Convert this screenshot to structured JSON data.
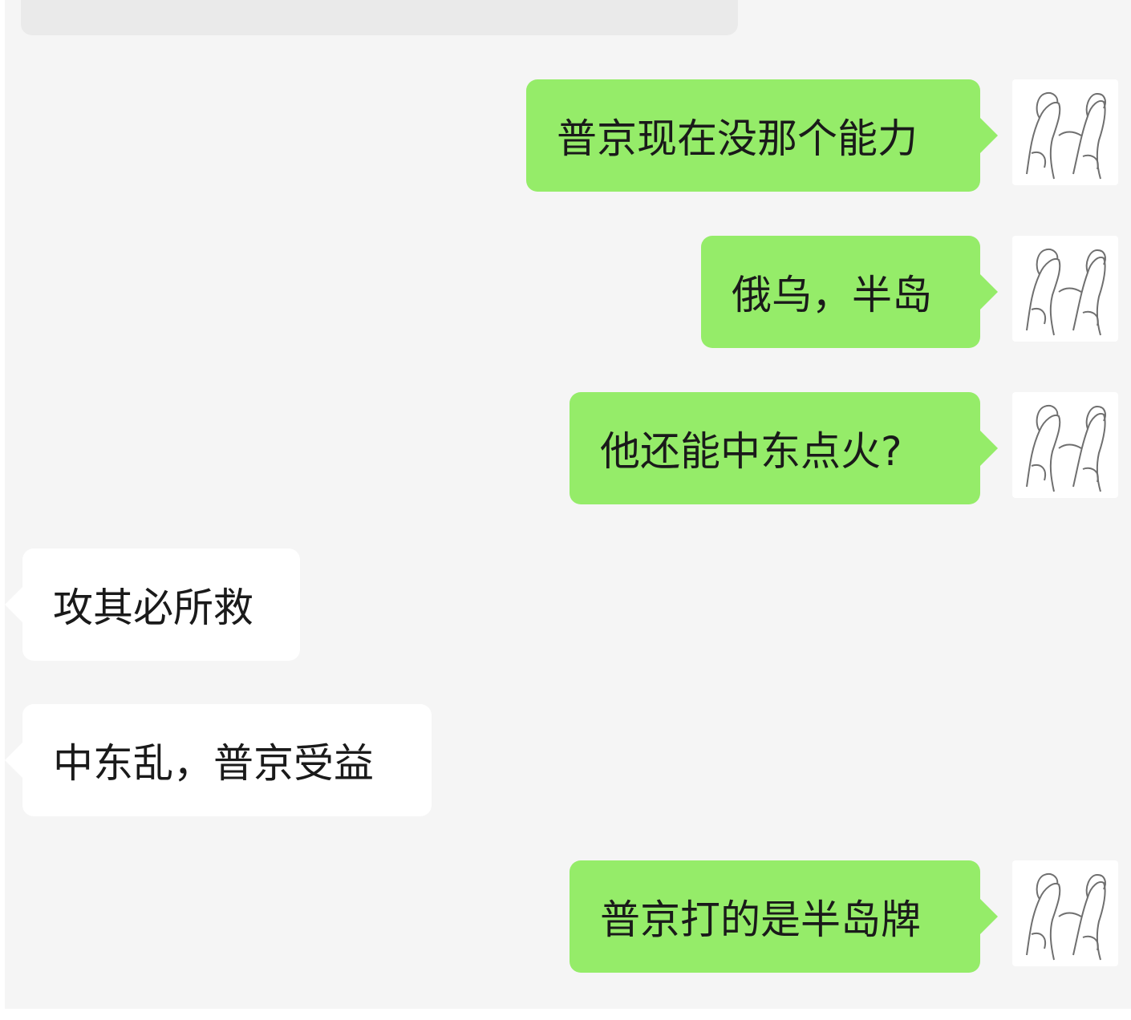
{
  "messages": [
    {
      "side": "me",
      "text": "普京现在没那个能力"
    },
    {
      "side": "me",
      "text": "俄乌，半岛"
    },
    {
      "side": "me",
      "text": "他还能中东点火?"
    },
    {
      "side": "other",
      "text": "攻其必所救"
    },
    {
      "side": "other",
      "text": "中东乱，普京受益"
    },
    {
      "side": "me",
      "text": "普京打的是半岛牌"
    }
  ],
  "avatar_icon": "sketch-figures-avatar-icon",
  "colors": {
    "chat_background": "#f5f5f5",
    "sent_bubble": "#95ec69",
    "received_bubble": "#ffffff"
  }
}
